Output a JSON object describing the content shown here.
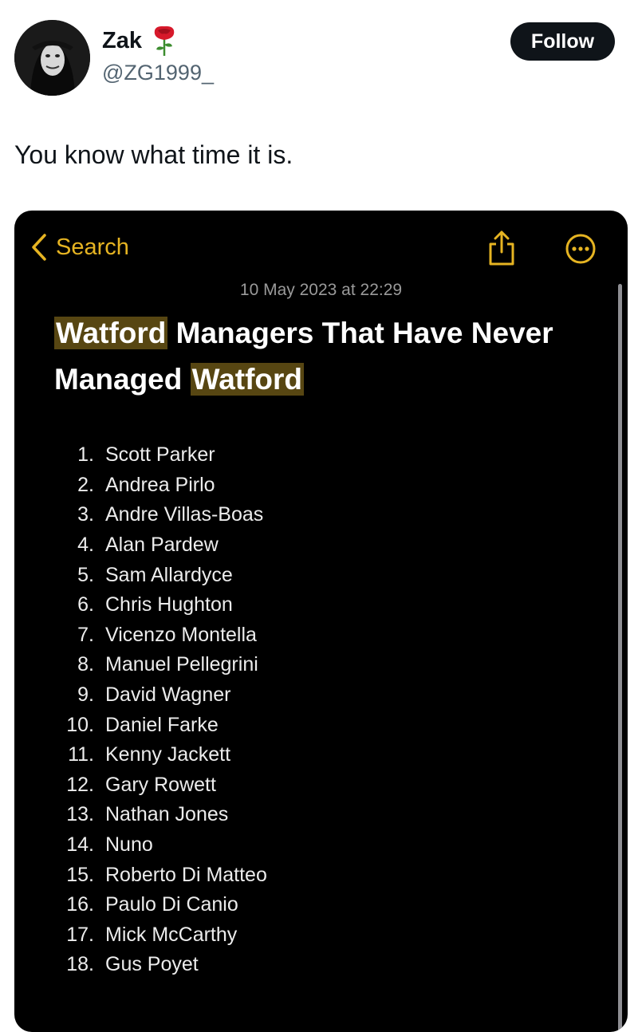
{
  "author": {
    "name": "Zak",
    "handle": "@ZG1999_",
    "follow_label": "Follow"
  },
  "tweet": {
    "text": "You know what time it is."
  },
  "note": {
    "back_label": "Search",
    "date": "10 May 2023 at 22:29",
    "title_parts": [
      "Watford",
      " Managers That Have Never Managed ",
      "Watford"
    ],
    "items": [
      {
        "n": "1.",
        "name": "Scott Parker"
      },
      {
        "n": "2.",
        "name": "Andrea Pirlo"
      },
      {
        "n": "3.",
        "name": "Andre Villas-Boas"
      },
      {
        "n": "4.",
        "name": "Alan Pardew"
      },
      {
        "n": "5.",
        "name": "Sam Allardyce"
      },
      {
        "n": "6.",
        "name": "Chris Hughton"
      },
      {
        "n": "7.",
        "name": "Vicenzo Montella"
      },
      {
        "n": "8.",
        "name": "Manuel Pellegrini"
      },
      {
        "n": "9.",
        "name": "David Wagner"
      },
      {
        "n": "10.",
        "name": "Daniel Farke"
      },
      {
        "n": "11.",
        "name": "Kenny Jackett"
      },
      {
        "n": "12.",
        "name": "Gary Rowett"
      },
      {
        "n": "13.",
        "name": "Nathan Jones"
      },
      {
        "n": "14.",
        "name": "Nuno"
      },
      {
        "n": "15.",
        "name": "Roberto Di Matteo"
      },
      {
        "n": "16.",
        "name": "Paulo Di Canio"
      },
      {
        "n": "17.",
        "name": "Mick McCarthy"
      },
      {
        "n": "18.",
        "name": "Gus Poyet"
      }
    ]
  },
  "icons": {
    "back": "chevron-left-icon",
    "share": "share-icon",
    "more": "ellipsis-circle-icon",
    "emoji": "rose-icon"
  },
  "colors": {
    "accent": "#e6b422",
    "highlight": "#574612",
    "follow_bg": "#0f1419"
  }
}
